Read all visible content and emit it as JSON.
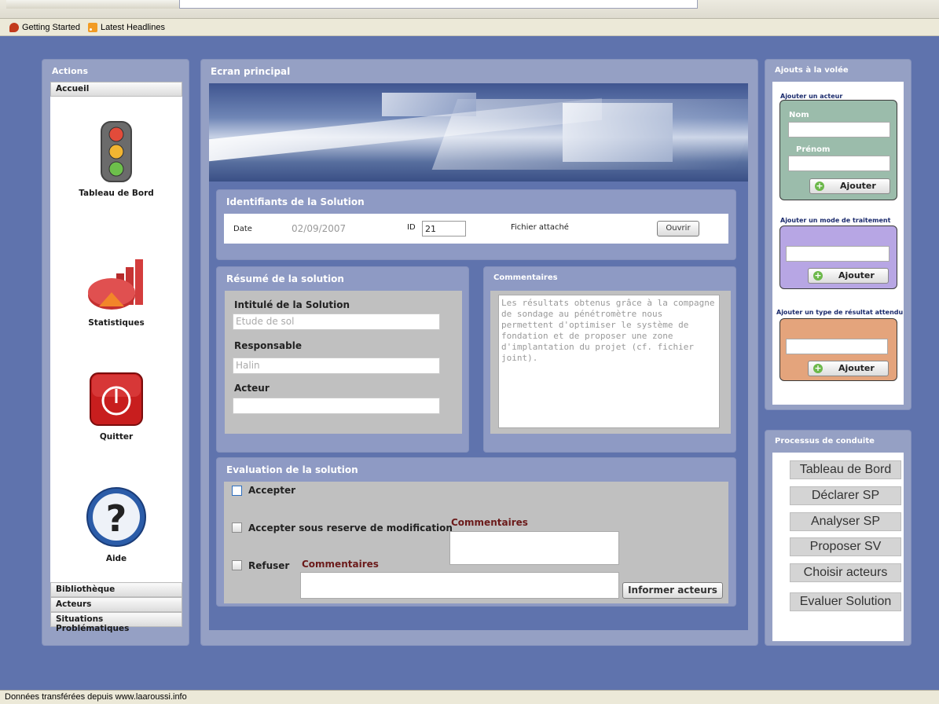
{
  "browser": {
    "bookmarks": [
      "Getting Started",
      "Latest Headlines"
    ],
    "status_text": "Données transférées depuis www.laaroussi.info"
  },
  "actions": {
    "title": "Actions",
    "active_tab": "Accueil",
    "entries": [
      {
        "label": "Tableau de Bord",
        "icon": "traffic-light-icon"
      },
      {
        "label": "Statistiques",
        "icon": "statistics-chart-icon"
      },
      {
        "label": "Quitter",
        "icon": "power-icon"
      },
      {
        "label": "Aide",
        "icon": "help-icon"
      }
    ],
    "bottom_tabs": [
      "Bibliothèque",
      "Acteurs",
      "Situations Problématiques"
    ]
  },
  "main": {
    "title": "Ecran principal",
    "identifiants": {
      "title": "Identifiants de la Solution",
      "date_label": "Date",
      "date_value": "02/09/2007",
      "id_label": "ID",
      "id_value": "21",
      "fichier_label": "Fichier attaché",
      "ouvrir_label": "Ouvrir"
    },
    "resume": {
      "title": "Résumé de la solution",
      "intitule_label": "Intitulé de la Solution",
      "intitule_value": "Etude de sol",
      "responsable_label": "Responsable",
      "responsable_value": "Halin",
      "acteur_label": "Acteur",
      "acteur_value": ""
    },
    "commentaires": {
      "title": "Commentaires",
      "text": "Les résultats obtenus grâce à la compagne de sondage au pénétromètre nous permettent d'optimiser le système de fondation et de proposer une zone d'implantation du projet (cf. fichier joint)."
    },
    "evaluation": {
      "title": "Evaluation de la solution",
      "accepter": "Accepter",
      "accepter_reserve": "Accepter sous reserve de modification",
      "refuser": "Refuser",
      "commentaires_label_1": "Commentaires",
      "commentaires_label_2": "Commentaires",
      "informer_label": "Informer acteurs"
    }
  },
  "ajouts": {
    "title": "Ajouts à la volée",
    "acteur": {
      "label": "Ajouter un acteur",
      "nom_label": "Nom",
      "prenom_label": "Prénom",
      "button": "Ajouter",
      "color": "#9bbcab"
    },
    "mode": {
      "label": "Ajouter un mode de traitement",
      "button": "Ajouter",
      "color": "#b7a6e4"
    },
    "resultat": {
      "label": "Ajouter un type de résultat attendu",
      "button": "Ajouter",
      "color": "#e4a47c"
    }
  },
  "processus": {
    "title": "Processus de conduite",
    "buttons": [
      "Tableau de Bord",
      "Déclarer SP",
      "Analyser SP",
      "Proposer SV",
      "Choisir acteurs",
      "Evaluer Solution"
    ]
  }
}
